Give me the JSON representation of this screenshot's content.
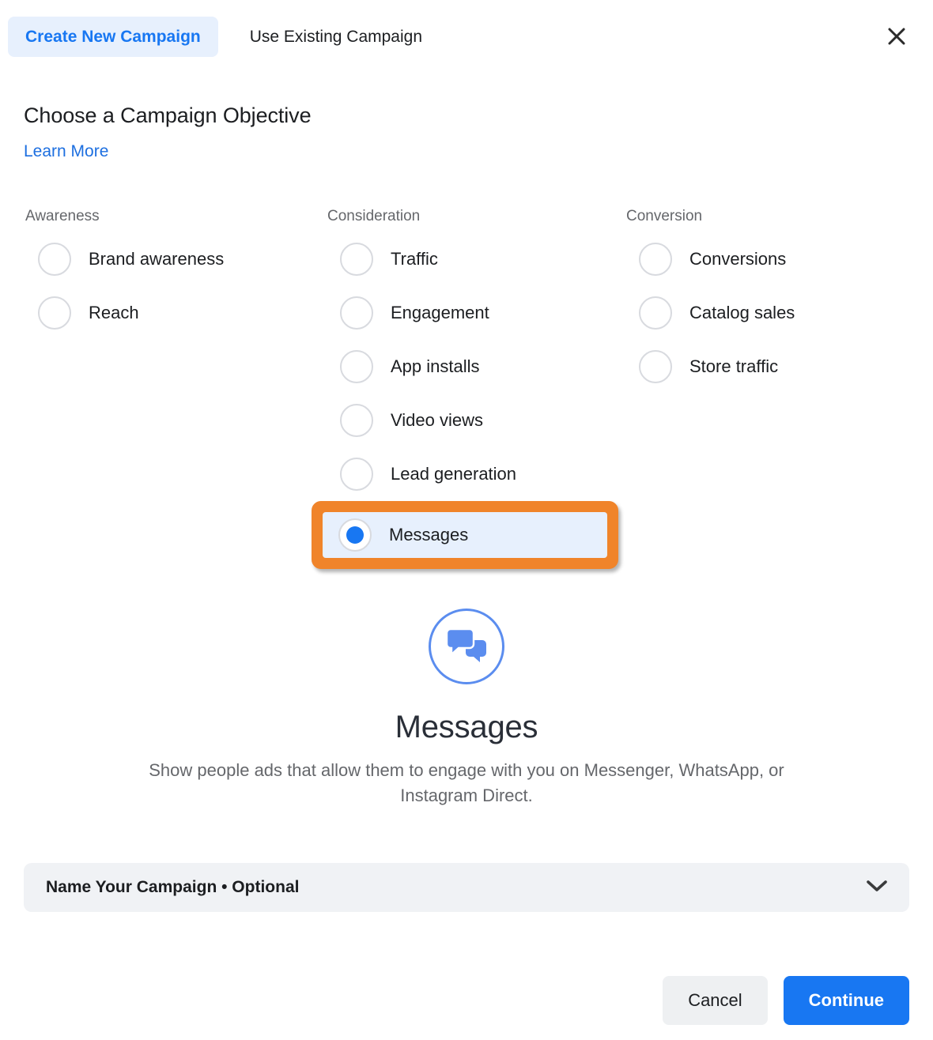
{
  "header": {
    "tabs": [
      {
        "label": "Create New Campaign",
        "active": true
      },
      {
        "label": "Use Existing Campaign",
        "active": false
      }
    ],
    "close_icon": "close-icon"
  },
  "section": {
    "title": "Choose a Campaign Objective",
    "learn_more": "Learn More"
  },
  "columns": [
    {
      "title": "Awareness",
      "options": [
        {
          "label": "Brand awareness",
          "selected": false
        },
        {
          "label": "Reach",
          "selected": false
        }
      ]
    },
    {
      "title": "Consideration",
      "options": [
        {
          "label": "Traffic",
          "selected": false
        },
        {
          "label": "Engagement",
          "selected": false
        },
        {
          "label": "App installs",
          "selected": false
        },
        {
          "label": "Video views",
          "selected": false
        },
        {
          "label": "Lead generation",
          "selected": false
        },
        {
          "label": "Messages",
          "selected": true,
          "highlighted": true
        }
      ]
    },
    {
      "title": "Conversion",
      "options": [
        {
          "label": "Conversions",
          "selected": false
        },
        {
          "label": "Catalog sales",
          "selected": false
        },
        {
          "label": "Store traffic",
          "selected": false
        }
      ]
    }
  ],
  "preview": {
    "icon": "chat-bubbles-icon",
    "title": "Messages",
    "description": "Show people ads that allow them to engage with you on Messenger, WhatsApp, or Instagram Direct."
  },
  "accordion": {
    "label": "Name Your Campaign • Optional",
    "chevron_icon": "chevron-down-icon"
  },
  "footer": {
    "cancel_label": "Cancel",
    "continue_label": "Continue"
  },
  "colors": {
    "accent_blue": "#1877f2",
    "link_blue": "#1d6fe0",
    "selected_row_bg": "#e7f0fd",
    "highlight_orange": "#f0842a",
    "muted_text": "#65676b",
    "panel_gray": "#f0f2f5"
  }
}
